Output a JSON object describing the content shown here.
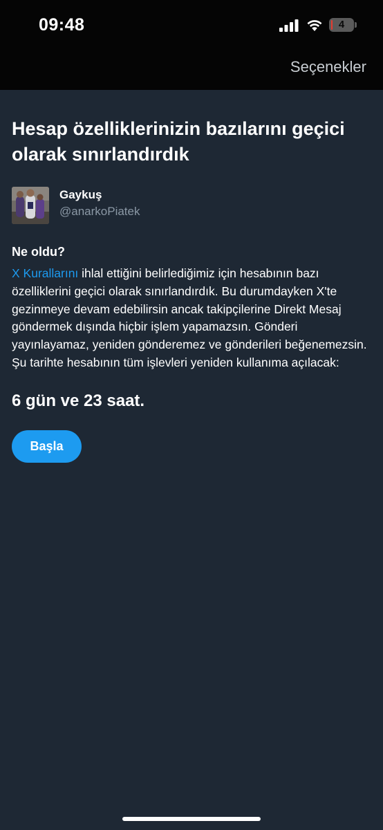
{
  "status_bar": {
    "time": "09:48",
    "battery_level": "4",
    "battery_fraction": 0.04,
    "battery_color": "#e83b30"
  },
  "header": {
    "options_label": "Seçenekler"
  },
  "main": {
    "title": "Hesap özelliklerinizin bazılarını geçici olarak sınırlandırdık",
    "account": {
      "name": "Gaykuş",
      "handle": "@anarkoPiatek"
    },
    "section_heading": "Ne oldu?",
    "rules_link": "X Kurallarını",
    "body": " ihlal ettiğini belirlediğimiz için hesabının bazı özelliklerini geçici olarak sınırlandırdık. Bu durumdayken X'te gezinmeye devam edebilirsin ancak takipçilerine Direkt Mesaj göndermek dışında hiçbir işlem yapamazsın. Gönderi yayınlayamaz, yeniden gönderemez ve gönderileri beğenemezsin. Şu tarihte hesabının tüm işlevleri yeniden kullanıma açılacak:",
    "countdown": "6 gün ve 23 saat.",
    "start_button": "Başla"
  },
  "colors": {
    "accent": "#1d9bf0",
    "background": "#1e2834",
    "secondary_text": "#8b98a5"
  }
}
